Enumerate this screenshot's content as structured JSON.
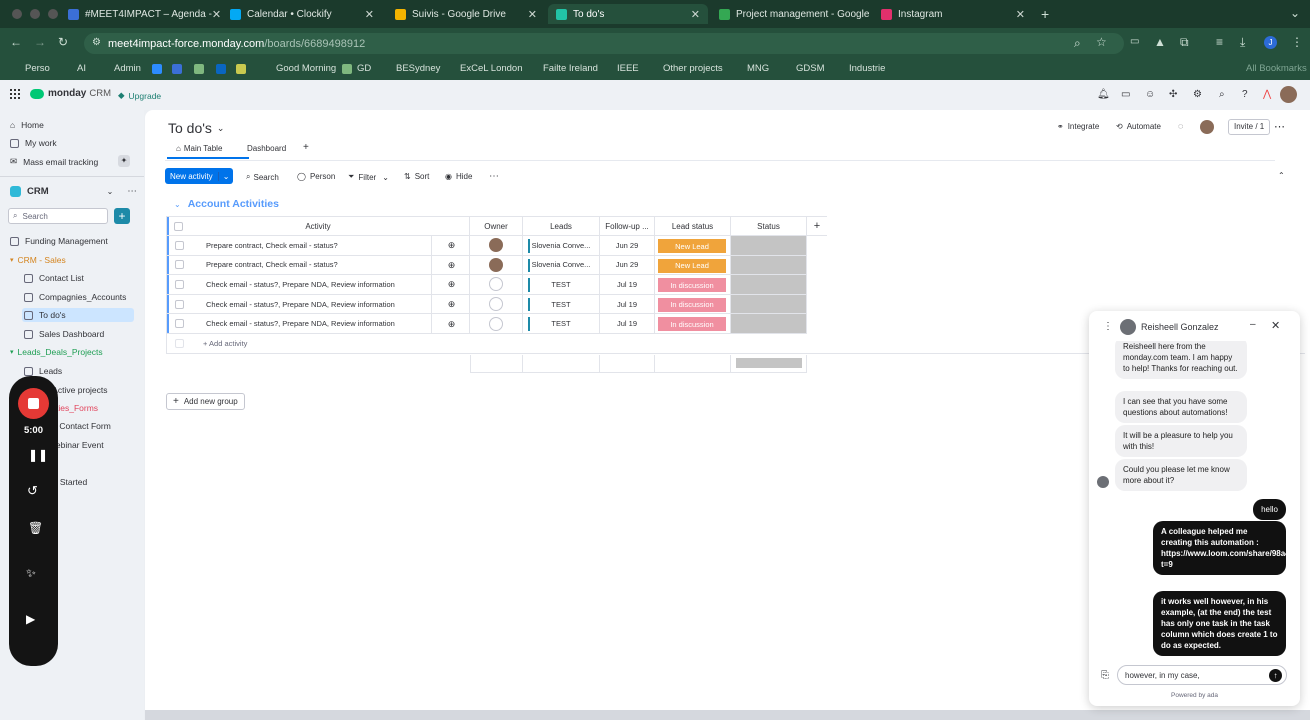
{
  "browser": {
    "tabs": [
      {
        "label": "#MEET4IMPACT – Agenda -",
        "color": "#3b6fd6"
      },
      {
        "label": "Calendar • Clockify",
        "color": "#03a9f4"
      },
      {
        "label": "Suivis - Google Drive",
        "color": "#f4b400"
      },
      {
        "label": "To do's",
        "color": "#22c3a6"
      },
      {
        "label": "Project management - Google",
        "color": "#34a853"
      },
      {
        "label": "Instagram",
        "color": "#e1306c"
      }
    ],
    "url_host": "meet4impact-force.monday.com",
    "url_path": "/boards/6689498912",
    "bookmarks": [
      "Perso",
      "AI",
      "Admin",
      "Good Morning",
      "GD",
      "BESydney",
      "ExCeL London",
      "Failte Ireland",
      "IEEE",
      "Other projects",
      "MNG",
      "GDSM",
      "Industrie"
    ],
    "bookmarks_right": "All Bookmarks"
  },
  "app": {
    "logo": "monday",
    "logo_sub": "CRM",
    "upgrade": "Upgrade"
  },
  "sidebar": {
    "home": "Home",
    "my_work": "My work",
    "mass_email": "Mass email tracking",
    "workspace": "CRM",
    "search_placeholder": "Search",
    "items": [
      {
        "label": "Funding Management",
        "type": "top"
      },
      {
        "label": "CRM - Sales",
        "type": "section"
      },
      {
        "label": "Contact List",
        "type": "sub"
      },
      {
        "label": "Compagnies_Accounts",
        "type": "sub"
      },
      {
        "label": "To do's",
        "type": "sub"
      },
      {
        "label": "Sales Dashboard",
        "type": "sub"
      },
      {
        "label": "Leads_Deals_Projects",
        "type": "section2"
      },
      {
        "label": "Leads",
        "type": "sub"
      },
      {
        "label": "/ Active projects",
        "type": "sub"
      },
      {
        "label": "ivities_Forms",
        "type": "subpink"
      },
      {
        "label": "ite Contact Form",
        "type": "sub"
      },
      {
        "label": "Webinar Event",
        "type": "sub"
      },
      {
        "label": "ng Started",
        "type": "sub"
      }
    ]
  },
  "board": {
    "title": "To do's",
    "tabs": [
      "Main Table",
      "Dashboard"
    ],
    "integrate": "Integrate",
    "automate": "Automate",
    "invite": "Invite / 1",
    "toolbar": {
      "new": "New activity",
      "search": "Search",
      "person": "Person",
      "filter": "Filter",
      "sort": "Sort",
      "hide": "Hide"
    },
    "group_title": "Account Activities",
    "columns": [
      "Activity",
      "Owner",
      "Leads",
      "Follow-up ...",
      "Lead status",
      "Status"
    ],
    "rows": [
      {
        "activity": "Prepare contract, Check email - status?",
        "owner": "photo",
        "lead": "Slovenia Conve...",
        "date": "Jun 29",
        "status": "New Lead",
        "status_color": "#f0a43b"
      },
      {
        "activity": "Prepare contract, Check email - status?",
        "owner": "photo",
        "lead": "Slovenia Conve...",
        "date": "Jun 29",
        "status": "New Lead",
        "status_color": "#f0a43b"
      },
      {
        "activity": "Check email - status?, Prepare NDA, Review information",
        "owner": "empty",
        "lead": "TEST",
        "date": "Jul 19",
        "status": "In discussion",
        "status_color": "#f08fa0"
      },
      {
        "activity": "Check email - status?, Prepare NDA, Review information",
        "owner": "empty",
        "lead": "TEST",
        "date": "Jul 19",
        "status": "In discussion",
        "status_color": "#f08fa0"
      },
      {
        "activity": "Check email - status?, Prepare NDA, Review information",
        "owner": "empty",
        "lead": "TEST",
        "date": "Jul 19",
        "status": "In discussion",
        "status_color": "#f08fa0"
      }
    ],
    "add_row": "+ Add activity",
    "add_group": "Add new group"
  },
  "loom": {
    "timer": "5:00"
  },
  "chat": {
    "agent": "Reisheell Gonzalez",
    "messages": [
      {
        "from": "agent",
        "text": "Reisheell here from the monday.com team. I am happy to help! Thanks for reaching out."
      },
      {
        "from": "agent",
        "text": "I can see that you have some questions about automations!"
      },
      {
        "from": "agent",
        "text": "It will be a pleasure to help you with this!"
      },
      {
        "from": "agent",
        "text": "Could you please let me know more about it?"
      },
      {
        "from": "user",
        "text": "hello"
      },
      {
        "from": "user",
        "text": "A colleague helped me creating this automation : https://www.loom.com/share/98a43993222e4a3fb58952b4127dc22c?t=9"
      },
      {
        "from": "user",
        "text": "it works well however, in his example, (at the end) the test has only one task in the task column which does create 1 to do as expected."
      }
    ],
    "input_value": "however, in my case,",
    "powered": "Powered by ada"
  }
}
